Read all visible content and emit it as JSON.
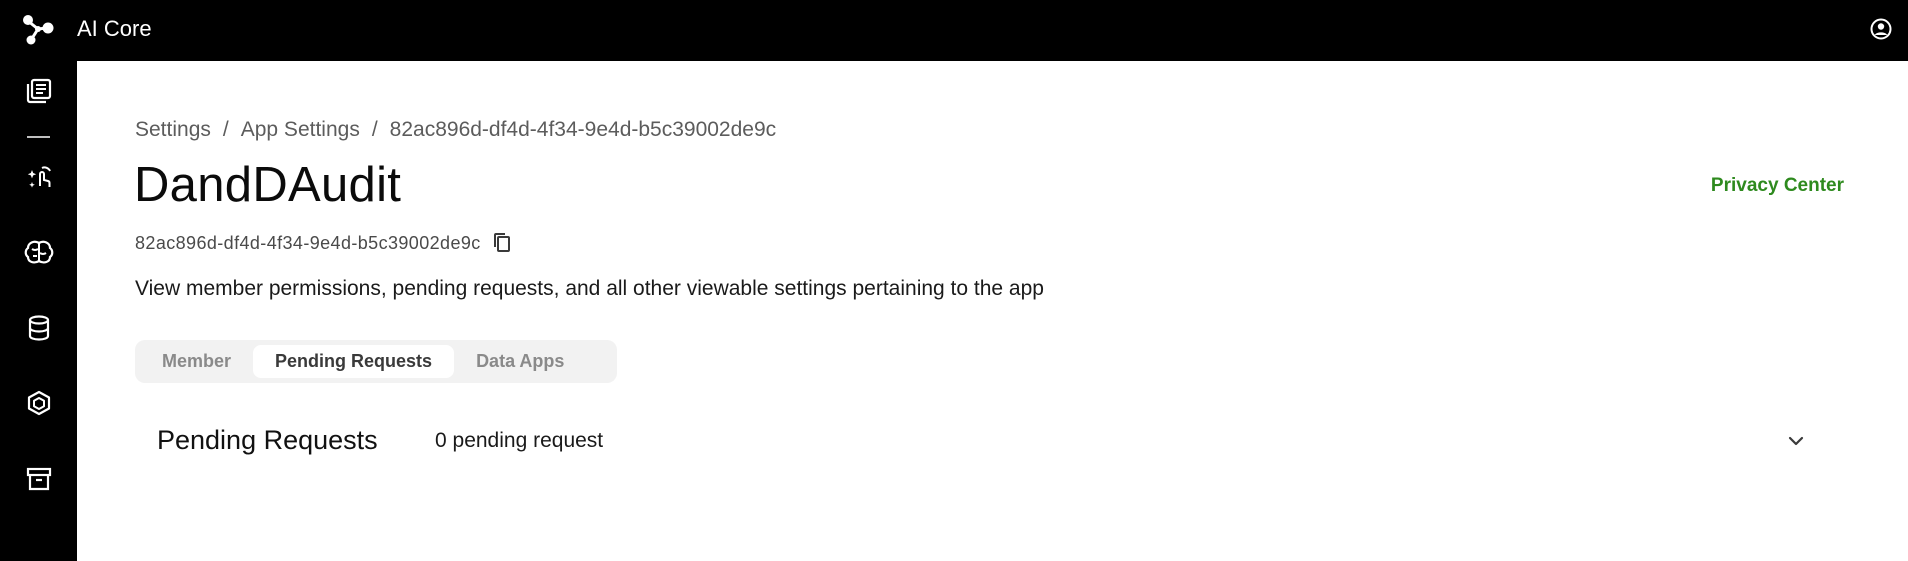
{
  "app": {
    "title": "AI Core"
  },
  "icons": {
    "logo": "molecule-logo-icon",
    "user": "account-circle-icon",
    "sidebar": [
      "library-icon",
      "sparkle-tap-icon",
      "brain-icon",
      "database-icon",
      "cube-icon",
      "archive-icon"
    ],
    "copy": "copy-icon",
    "chevron": "chevron-down-icon"
  },
  "breadcrumb": {
    "items": [
      "Settings",
      "App Settings",
      "82ac896d-df4d-4f34-9e4d-b5c39002de9c"
    ],
    "separator": "/"
  },
  "page": {
    "title": "DandDAudit",
    "app_id": "82ac896d-df4d-4f34-9e4d-b5c39002de9c",
    "description": "View member permissions, pending requests, and all other viewable settings pertaining to the app",
    "privacy_link": "Privacy Center"
  },
  "tabs": [
    {
      "label": "Member",
      "active": false
    },
    {
      "label": "Pending Requests",
      "active": true
    },
    {
      "label": "Data Apps",
      "active": false
    }
  ],
  "pending_section": {
    "title": "Pending Requests",
    "count_text": "0 pending request"
  },
  "colors": {
    "topbar": "#000000",
    "sidebar": "#000000",
    "link": "#2e8a1e",
    "tab_bg": "#f2f2f2"
  }
}
